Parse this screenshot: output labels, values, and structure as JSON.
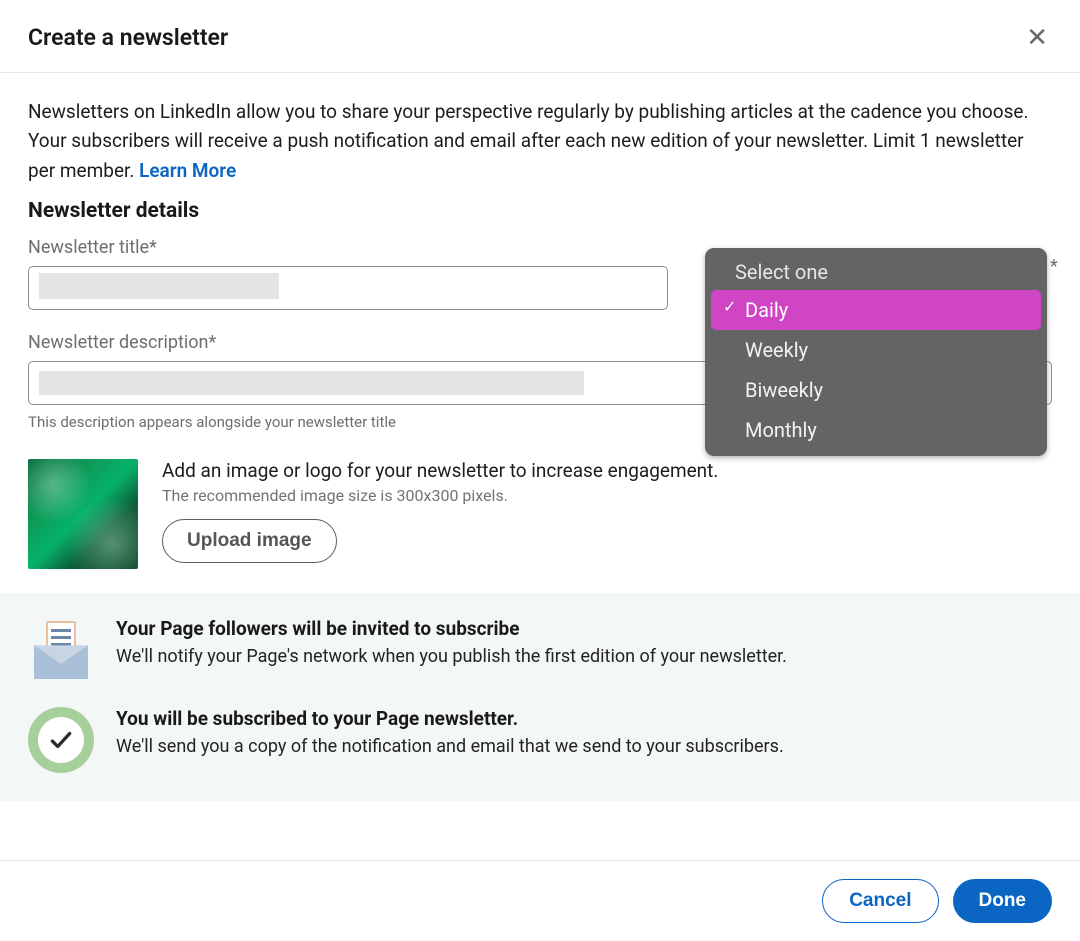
{
  "header": {
    "title": "Create a newsletter"
  },
  "intro": {
    "text": "Newsletters on LinkedIn allow you to share your perspective regularly by publishing articles at the cadence you choose. Your subscribers will receive a push notification and email after each new edition of your newsletter. Limit 1 newsletter per member. ",
    "link": "Learn More"
  },
  "section_title": "Newsletter details",
  "fields": {
    "title_label": "Newsletter title*",
    "cadence_asterisk": "*",
    "description_label": "Newsletter description*",
    "description_helper": "This description appears alongside your newsletter title"
  },
  "cadence_dropdown": {
    "placeholder": "Select one",
    "options": [
      "Daily",
      "Weekly",
      "Biweekly",
      "Monthly"
    ],
    "selected": "Daily"
  },
  "upload": {
    "headline": "Add an image or logo for your newsletter to increase engagement.",
    "subtext": "The recommended image size is 300x300 pixels.",
    "button": "Upload image"
  },
  "info": {
    "invite": {
      "title": "Your Page followers will be invited to subscribe",
      "body": "We'll notify your Page's network when you publish the first edition of your newsletter."
    },
    "subscribed": {
      "title": "You will be subscribed to your Page newsletter.",
      "body": "We'll send you a copy of the notification and email that we send to your subscribers."
    }
  },
  "footer": {
    "cancel": "Cancel",
    "done": "Done"
  }
}
